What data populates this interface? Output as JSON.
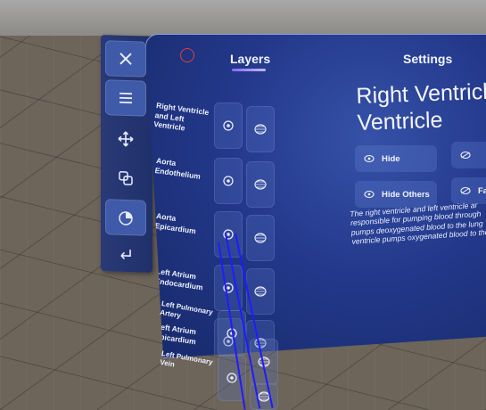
{
  "toolbar": {
    "buttons": [
      {
        "name": "close-icon",
        "active": true
      },
      {
        "name": "menu-icon",
        "active": true
      },
      {
        "name": "move-icon",
        "active": false
      },
      {
        "name": "layers-overlap-icon",
        "active": false
      },
      {
        "name": "pie-chart-icon",
        "active": true
      },
      {
        "name": "return-icon",
        "active": false
      }
    ]
  },
  "panel": {
    "tabs": {
      "layers": "Layers",
      "settings": "Settings"
    },
    "layers": [
      {
        "name": "Right Ventricle and Left Ventricle"
      },
      {
        "name": "Aorta Endothelium"
      },
      {
        "name": "Aorta Epicardium"
      },
      {
        "name": "Left Atrium Endocardium"
      },
      {
        "name": "Left Atrium Epicardium"
      },
      {
        "name": "Left Pulmonary Artery"
      },
      {
        "name": "Left Pulmonary Vein"
      }
    ],
    "detail": {
      "title_line1": "Right Ventricle",
      "title_line2": "Ventricle",
      "hide": "Hide",
      "hide_others": "Hide Others",
      "partial_fade": "Fac",
      "desc_line1": "The right ventricle and left ventricle ar",
      "desc_line2": "responsible for pumping blood through",
      "desc_line3": "pumps deoxygenated blood to the lung",
      "desc_line4": "ventricle pumps oxygenated blood to the"
    }
  },
  "colors": {
    "accent": "#8a6cf0",
    "close_dot": "#e23d3d",
    "guide_lines": "#1f1cff"
  }
}
